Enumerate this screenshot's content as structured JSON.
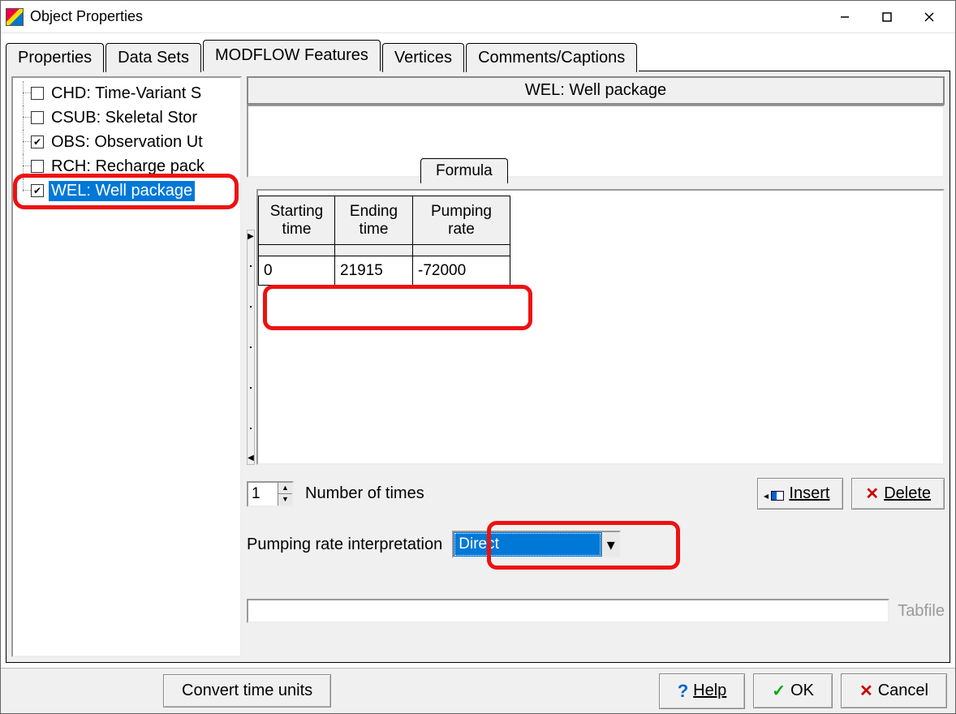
{
  "window": {
    "title": "Object Properties"
  },
  "tabs": {
    "properties": "Properties",
    "datasets": "Data Sets",
    "modflow": "MODFLOW Features",
    "vertices": "Vertices",
    "comments": "Comments/Captions"
  },
  "tree": {
    "chd": {
      "label": "CHD: Time-Variant S",
      "checked": false
    },
    "csub": {
      "label": "CSUB: Skeletal Stor",
      "checked": false
    },
    "obs": {
      "label": "OBS: Observation Ut",
      "checked": true
    },
    "rch": {
      "label": "RCH: Recharge pack",
      "checked": false
    },
    "wel": {
      "label": "WEL: Well package",
      "checked": true,
      "selected": true
    }
  },
  "panel": {
    "title": "WEL: Well package",
    "formula_tab": "Formula",
    "columns": {
      "start": "Starting time",
      "end": "Ending time",
      "pump": "Pumping rate"
    },
    "row": {
      "start": "0",
      "end": "21915",
      "pump": "-72000"
    },
    "num_times_value": "1",
    "num_times_label": "Number of times",
    "insert": "Insert",
    "delete": "Delete",
    "interp_label": "Pumping rate interpretation",
    "interp_value": "Direct",
    "tabfile_label": "Tabfile"
  },
  "bottom": {
    "convert": "Convert time units",
    "help": "Help",
    "ok": "OK",
    "cancel": "Cancel"
  }
}
